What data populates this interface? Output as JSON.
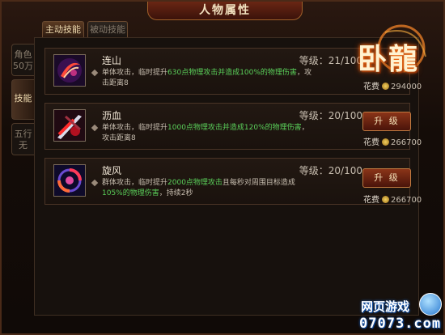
{
  "window": {
    "title": "人物属性",
    "close_label": "✕"
  },
  "top_tabs": [
    {
      "label": "主动技能",
      "active": true
    },
    {
      "label": "被动技能",
      "active": false
    }
  ],
  "side_tabs": [
    {
      "line1": "角色",
      "line2": "50万"
    },
    {
      "line1": "技能"
    },
    {
      "line1": "五行",
      "line2": "无"
    }
  ],
  "skills": [
    {
      "name": "连山",
      "level": "等级：21/100",
      "desc_parts": [
        "单体攻击，临时提升",
        "630点物理攻击并造成",
        "100%的物理伤害",
        "，攻击距离8"
      ],
      "cost_label": "花费",
      "cost_value": "294000",
      "icon": "crescent-slash-icon",
      "upgrade_label": ""
    },
    {
      "name": "沥血",
      "level": "等级：20/100",
      "desc_parts": [
        "单体攻击，临时提升",
        "1000点物理攻击并造成",
        "120%的物理伤害",
        "，攻击距离8"
      ],
      "cost_label": "花费",
      "cost_value": "266700",
      "icon": "blood-blade-icon",
      "upgrade_label": "升 级"
    },
    {
      "name": "旋风",
      "level": "等级：20/100",
      "desc_parts": [
        "群体攻击，临时提升",
        "2000点物理攻击",
        "且每秒对周围目标造成",
        "105%的物理伤害",
        "，持续2秒"
      ],
      "cost_label": "花费",
      "cost_value": "266700",
      "icon": "whirlwind-icon",
      "upgrade_label": "升 级"
    }
  ],
  "logo": {
    "text": "卧龍"
  },
  "watermark": {
    "top": "网页游戏",
    "bottom": "07073.com"
  },
  "colors": {
    "highlight": "#5ad05a",
    "frame": "#4a2a18",
    "button": "#8a3418"
  }
}
